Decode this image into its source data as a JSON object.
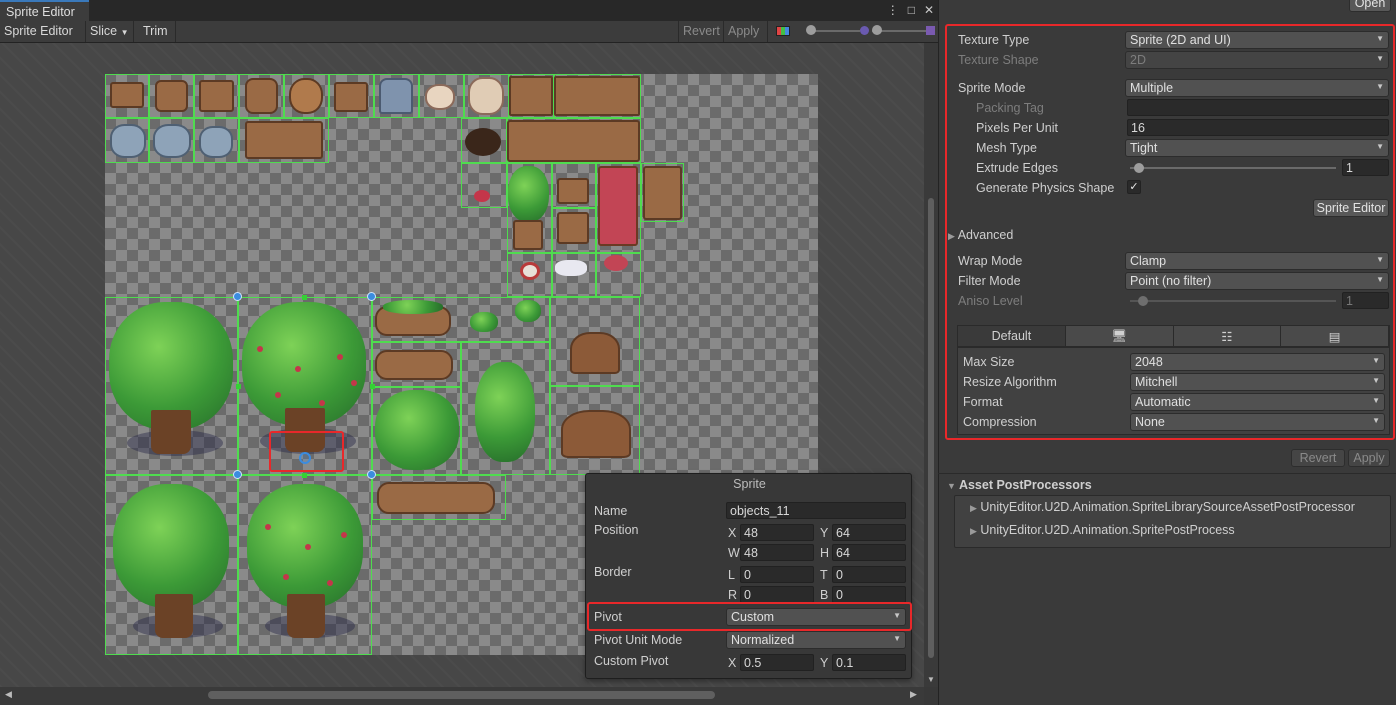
{
  "window": {
    "tab_title": "Sprite Editor",
    "win_icons": [
      "⋮",
      "□",
      "✕"
    ]
  },
  "toolbar": {
    "sprite_editor": "Sprite Editor",
    "slice": "Slice",
    "trim": "Trim",
    "revert": "Revert",
    "apply": "Apply"
  },
  "sprite_panel": {
    "title": "Sprite",
    "name_label": "Name",
    "name_value": "objects_11",
    "position_label": "Position",
    "x_label": "X",
    "x_value": "48",
    "y_label": "Y",
    "y_value": "64",
    "w_label": "W",
    "w_value": "48",
    "h_label": "H",
    "h_value": "64",
    "border_label": "Border",
    "l_label": "L",
    "l_value": "0",
    "t_label": "T",
    "t_value": "0",
    "r_label": "R",
    "r_value": "0",
    "b_label": "B",
    "b_value": "0",
    "pivot_label": "Pivot",
    "pivot_value": "Custom",
    "pivot_unit_label": "Pivot Unit Mode",
    "pivot_unit_value": "Normalized",
    "custom_pivot_label": "Custom Pivot",
    "cp_x_label": "X",
    "cp_x_value": "0.5",
    "cp_y_label": "Y",
    "cp_y_value": "0.1"
  },
  "inspector": {
    "open_button": "Open",
    "texture_type_label": "Texture Type",
    "texture_type_value": "Sprite (2D and UI)",
    "texture_shape_label": "Texture Shape",
    "texture_shape_value": "2D",
    "sprite_mode_label": "Sprite Mode",
    "sprite_mode_value": "Multiple",
    "packing_tag_label": "Packing Tag",
    "packing_tag_value": "",
    "ppu_label": "Pixels Per Unit",
    "ppu_value": "16",
    "mesh_type_label": "Mesh Type",
    "mesh_type_value": "Tight",
    "extrude_label": "Extrude Edges",
    "extrude_value": "1",
    "gen_physics_label": "Generate Physics Shape",
    "sprite_editor_button": "Sprite Editor",
    "advanced_label": "Advanced",
    "wrap_mode_label": "Wrap Mode",
    "wrap_mode_value": "Clamp",
    "filter_mode_label": "Filter Mode",
    "filter_mode_value": "Point (no filter)",
    "aniso_label": "Aniso Level",
    "aniso_value": "1",
    "platform_tabs": [
      "Default",
      "🖥",
      "☷",
      "▤"
    ],
    "max_size_label": "Max Size",
    "max_size_value": "2048",
    "resize_label": "Resize Algorithm",
    "resize_value": "Mitchell",
    "format_label": "Format",
    "format_value": "Automatic",
    "compression_label": "Compression",
    "compression_value": "None",
    "revert": "Revert",
    "apply": "Apply",
    "asset_postprocessors_label": "Asset PostProcessors",
    "postprocessors": [
      "UnityEditor.U2D.Animation.SpriteLibrarySourceAssetPostProcessor",
      "UnityEditor.U2D.Animation.SpritePostProcess"
    ]
  }
}
